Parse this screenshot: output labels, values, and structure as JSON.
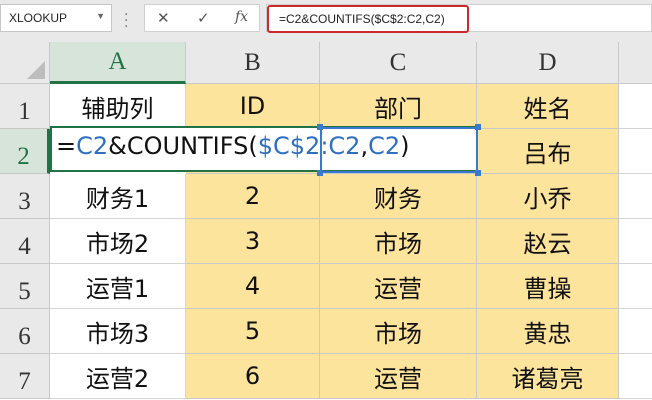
{
  "name_box": {
    "value": "XLOOKUP"
  },
  "formula_bar": {
    "cancel_glyph": "✕",
    "enter_glyph": "✓",
    "fx_glyph": "fx",
    "formula": "=C2&COUNTIFS($C$2:C2,C2)"
  },
  "columns": [
    "A",
    "B",
    "C",
    "D"
  ],
  "rows": [
    "1",
    "2",
    "3",
    "4",
    "5",
    "6",
    "7"
  ],
  "edit_cell": {
    "prefix": "=",
    "ref_a": "C2",
    "mid": "&COUNTIFS(",
    "ref_b": "$C$2:C2",
    "comma": ",",
    "ref_c": "C2",
    "suffix": ")"
  },
  "sheet": {
    "header": [
      "辅助列",
      "ID",
      "部门",
      "姓名"
    ],
    "row2": [
      "",
      "",
      "",
      "吕布"
    ],
    "row3": [
      "财务1",
      "2",
      "财务",
      "小乔"
    ],
    "row4": [
      "市场2",
      "3",
      "市场",
      "赵云"
    ],
    "row5": [
      "运营1",
      "4",
      "运营",
      "曹操"
    ],
    "row6": [
      "市场3",
      "5",
      "市场",
      "黄忠"
    ],
    "row7": [
      "运营2",
      "6",
      "运营",
      "诸葛亮"
    ]
  },
  "colors": {
    "fill": "#fde49c",
    "accent": "#217346",
    "ref": "#2f6fbf",
    "highlight_border": "#cc2a2a"
  }
}
